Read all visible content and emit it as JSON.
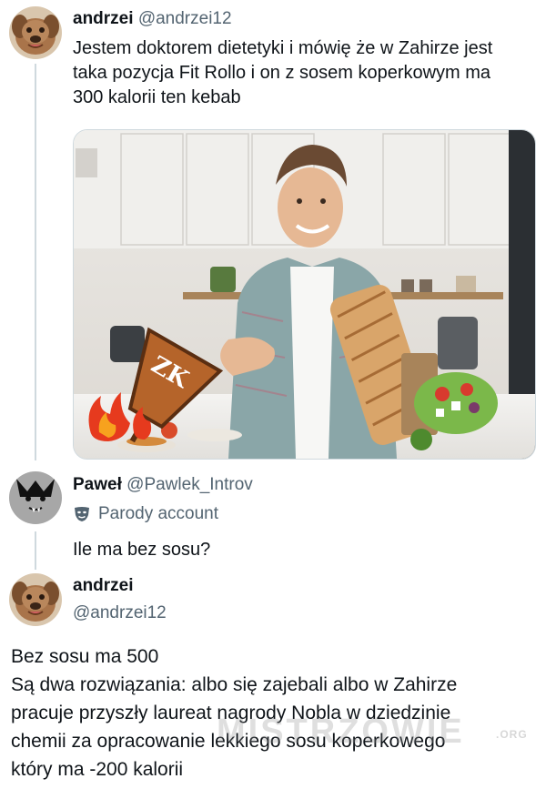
{
  "tweet1": {
    "name": "andrzei",
    "handle": "@andrzei12",
    "lines": [
      "Jestem doktorem dietetyki i mówię że w Zahirze jest",
      "taka pozycja Fit Rollo i on z sosem koperkowym ma",
      "300 kalorii ten kebab"
    ],
    "media": {
      "logo_text": "ZK"
    }
  },
  "tweet2": {
    "name": "Paweł",
    "handle": "@Pawlek_Introv",
    "badge": "Parody account",
    "text": "Ile ma bez sosu?"
  },
  "tweet3": {
    "name": "andrzei",
    "handle": "@andrzei12",
    "lines": [
      "Bez sosu ma 500",
      "Są dwa rozwiązania: albo się zajebali albo w Zahirze",
      "pracuje przyszły laureat nagrody Nobla w dziedzinie",
      "chemii za opracowanie lekkiego sosu koperkowego",
      "który ma -200 kalorii"
    ]
  },
  "watermark": {
    "text": "MISTRZOWIE",
    "suffix": ".ORG"
  },
  "colors": {
    "text": "#0f1419",
    "secondary": "#536471",
    "thread_line": "#cfd9de"
  }
}
